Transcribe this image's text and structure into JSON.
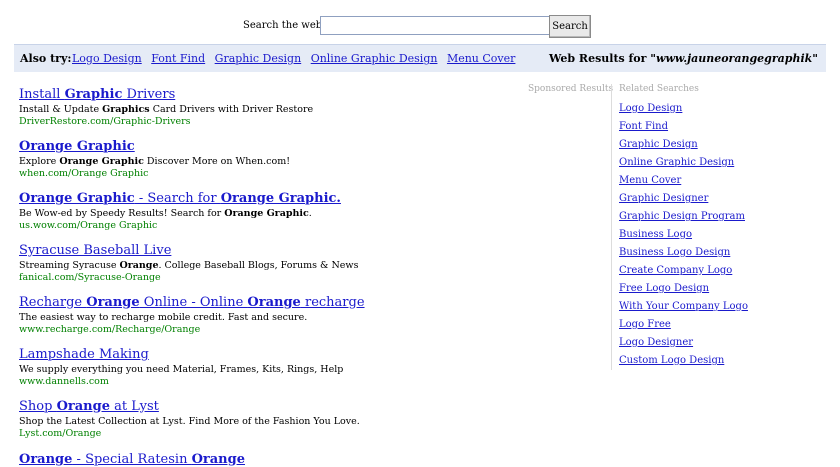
{
  "search": {
    "label": "Search the web:",
    "value": "",
    "button_label": "Search"
  },
  "also_try": {
    "label": "Also try:",
    "links": [
      "Logo Design",
      "Font Find",
      "Graphic Design",
      "Online Graphic Design",
      "Menu Cover"
    ]
  },
  "web_results": {
    "prefix": "Web Results for",
    "query": "\"www.jauneorangegraphik\""
  },
  "sponsored_label": "Sponsored Results",
  "results": [
    {
      "title": [
        {
          "t": "Install ",
          "b": false
        },
        {
          "t": "Graphic",
          "b": true
        },
        {
          "t": " Drivers",
          "b": false
        }
      ],
      "desc": [
        {
          "t": "Install & Update ",
          "b": false
        },
        {
          "t": "Graphics",
          "b": true
        },
        {
          "t": " Card Drivers with Driver Restore",
          "b": false
        }
      ],
      "url": "DriverRestore.com/Graphic-Drivers"
    },
    {
      "title": [
        {
          "t": "Orange Graphic",
          "b": true
        }
      ],
      "desc": [
        {
          "t": "Explore ",
          "b": false
        },
        {
          "t": "Orange Graphic",
          "b": true
        },
        {
          "t": " Discover More on When.com!",
          "b": false
        }
      ],
      "url": "when.com/Orange Graphic"
    },
    {
      "title": [
        {
          "t": "Orange Graphic",
          "b": true
        },
        {
          "t": " - Search for ",
          "b": false
        },
        {
          "t": "Orange Graphic.",
          "b": true
        }
      ],
      "desc": [
        {
          "t": "Be Wow-ed by Speedy Results! Search for ",
          "b": false
        },
        {
          "t": "Orange Graphic",
          "b": true
        },
        {
          "t": ".",
          "b": false
        }
      ],
      "url": "us.wow.com/Orange Graphic"
    },
    {
      "title": [
        {
          "t": "Syracuse Baseball Live",
          "b": false
        }
      ],
      "desc": [
        {
          "t": "Streaming Syracuse ",
          "b": false
        },
        {
          "t": "Orange",
          "b": true
        },
        {
          "t": ". College Baseball Blogs, Forums & News",
          "b": false
        }
      ],
      "url": "fanical.com/Syracuse-Orange"
    },
    {
      "title": [
        {
          "t": "Recharge ",
          "b": false
        },
        {
          "t": "Orange",
          "b": true
        },
        {
          "t": " Online - Online ",
          "b": false
        },
        {
          "t": "Orange",
          "b": true
        },
        {
          "t": " recharge",
          "b": false
        }
      ],
      "desc": [
        {
          "t": "The easiest way to recharge mobile credit. Fast and secure.",
          "b": false
        }
      ],
      "url": "www.recharge.com/Recharge/Orange"
    },
    {
      "title": [
        {
          "t": "Lampshade Making",
          "b": false
        }
      ],
      "desc": [
        {
          "t": "We supply everything you need Material, Frames, Kits, Rings, Help",
          "b": false
        }
      ],
      "url": "www.dannells.com"
    },
    {
      "title": [
        {
          "t": "Shop ",
          "b": false
        },
        {
          "t": "Orange",
          "b": true
        },
        {
          "t": " at Lyst",
          "b": false
        }
      ],
      "desc": [
        {
          "t": "Shop the Latest Collection at Lyst. Find More of the Fashion You Love.",
          "b": false
        }
      ],
      "url": "Lyst.com/Orange"
    }
  ],
  "partial_result": [
    {
      "t": "Orange",
      "b": true
    },
    {
      "t": " - Special Ratesin ",
      "b": false
    },
    {
      "t": "Orange",
      "b": true
    }
  ],
  "related": {
    "header": "Related Searches",
    "links": [
      "Logo Design",
      "Font Find",
      "Graphic Design",
      "Online Graphic Design",
      "Menu Cover",
      "Graphic Designer",
      "Graphic Design Program",
      "Business Logo",
      "Business Logo Design",
      "Create Company Logo",
      "Free Logo Design",
      "With Your Company Logo",
      "Logo Free",
      "Logo Designer",
      "Custom Logo Design"
    ]
  }
}
